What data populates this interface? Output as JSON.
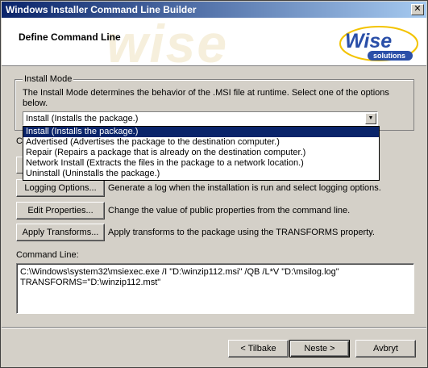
{
  "window": {
    "title": "Windows Installer Command Line Builder",
    "close_glyph": "✕"
  },
  "header": {
    "title": "Define Command Line",
    "watermark": "wise",
    "logo": {
      "brand": "Wise",
      "sub": "solutions",
      "brand_color": "#2a4fa8",
      "accent_color": "#f3c300"
    }
  },
  "install_mode": {
    "legend": "Install Mode",
    "description": "The Install Mode determines the behavior of the .MSI file at runtime. Select one of the options below.",
    "selected": "Install  (Installs the package.)",
    "options": [
      "Install  (Installs the package.)",
      "Advertised  (Advertises the package to the destination computer.)",
      "Repair  (Repairs a package that is already on the destination computer.)",
      "Network Install  (Extracts the files in the package to a network location.)",
      "Uninstall  (Uninstalls the package.)"
    ],
    "highlighted_index": 0
  },
  "options_label_partial": "C",
  "actions": [
    {
      "label": "Logging Options...",
      "description": "Generate a log when the installation is run and select logging options."
    },
    {
      "label": "Edit Properties...",
      "description": "Change the value of public properties from the command line."
    },
    {
      "label": "Apply Transforms...",
      "description": "Apply transforms to the package using the TRANSFORMS property."
    }
  ],
  "command_line": {
    "label": "Command Line:",
    "value": "C:\\Windows\\system32\\msiexec.exe /I \"D:\\winzip112.msi\" /QB /L*V \"D:\\msilog.log\" TRANSFORMS=\"D:\\winzip112.mst\""
  },
  "footer": {
    "back": "< Tilbake",
    "next": "Neste >",
    "cancel": "Avbryt"
  }
}
